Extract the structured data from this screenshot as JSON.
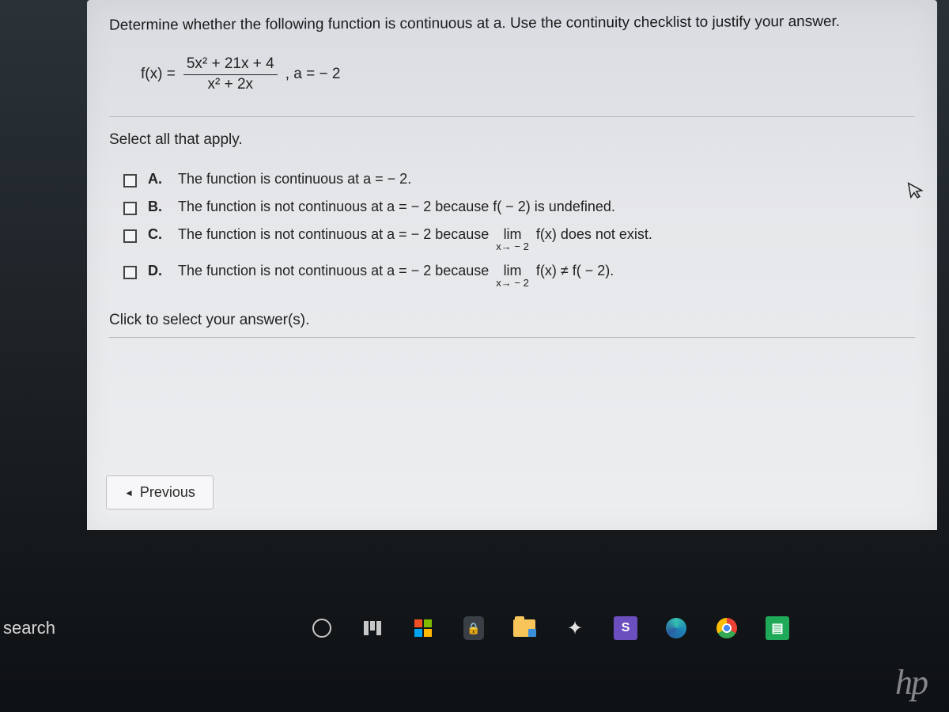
{
  "question": {
    "prompt": "Determine whether the following function is continuous at a. Use the continuity checklist to justify your answer.",
    "formula": {
      "lhs": "f(x) =",
      "numerator": "5x² + 21x + 4",
      "denominator": "x² + 2x",
      "a_clause": ", a = − 2"
    },
    "select_label": "Select all that apply.",
    "options": [
      {
        "letter": "A.",
        "text": "The function is continuous at a = − 2."
      },
      {
        "letter": "B.",
        "text": "The function is not continuous at a = − 2 because f( − 2) is undefined."
      },
      {
        "letter": "C.",
        "text_pre": "The function is not continuous at a = − 2 because",
        "lim_label": "lim",
        "lim_sub": "x→ − 2",
        "text_post": "f(x) does not exist."
      },
      {
        "letter": "D.",
        "text_pre": "The function is not continuous at a = − 2 because",
        "lim_label": "lim",
        "lim_sub": "x→ − 2",
        "text_post": "f(x) ≠ f( − 2)."
      }
    ],
    "click_label": "Click to select your answer(s).",
    "prev_button": "Previous"
  },
  "taskbar": {
    "search_label": "search",
    "hp": "hp"
  }
}
